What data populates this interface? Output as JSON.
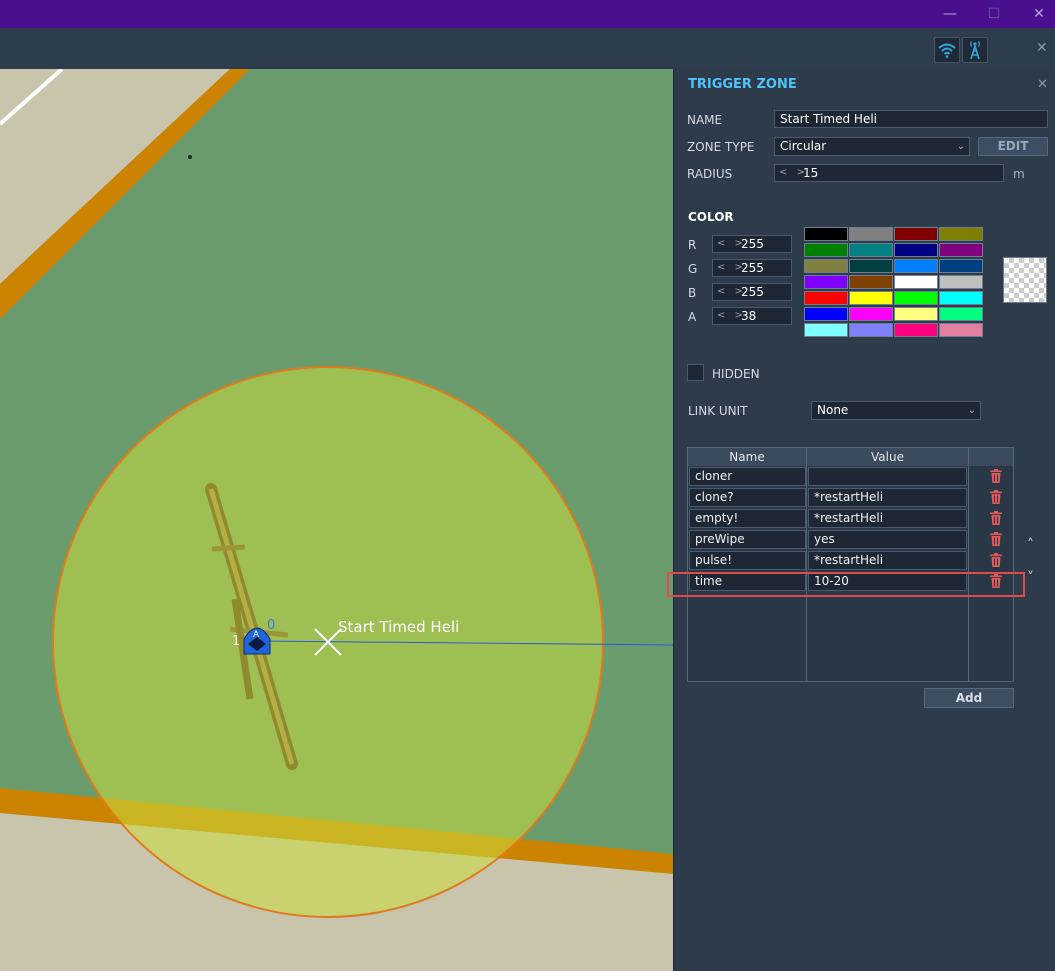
{
  "window": {
    "minimize_glyph": "—",
    "maximize_glyph": "☐",
    "close_glyph": "✕",
    "accent_color": "#4a0f8f"
  },
  "toolbar": {
    "icons": [
      "wifi-icon",
      "radio-tower-icon"
    ],
    "close_glyph": "✕"
  },
  "map": {
    "zone_label": "Start Timed Heli",
    "unit_marker_left_label": "1",
    "unit_marker_right_label": "0",
    "unit_marker_letter": "A",
    "zone_fill_color": "#c8dc3c",
    "zone_fill_opacity": 0.55,
    "zone_border_color": "#e07a1c"
  },
  "panel": {
    "title": "TRIGGER ZONE",
    "close_glyph": "✕",
    "name_label": "NAME",
    "name_value": "Start Timed Heli",
    "zone_type_label": "ZONE TYPE",
    "zone_type_value": "Circular",
    "edit_label": "EDIT",
    "radius_label": "RADIUS",
    "radius_value": "15",
    "radius_unit": "m",
    "color": {
      "section_label": "COLOR",
      "r_label": "R",
      "r_value": "255",
      "g_label": "G",
      "g_value": "255",
      "b_label": "B",
      "b_value": "255",
      "a_label": "A",
      "a_value": "38",
      "palette": [
        "#000000",
        "#808080",
        "#800000",
        "#808000",
        "#008000",
        "#008080",
        "#000080",
        "#800080",
        "#808040",
        "#004040",
        "#0080ff",
        "#004080",
        "#8000ff",
        "#804000",
        "#ffffff",
        "#c0c0c0",
        "#ff0000",
        "#ffff00",
        "#00ff00",
        "#00ffff",
        "#0000ff",
        "#ff00ff",
        "#ffff80",
        "#00ff80",
        "#80ffff",
        "#8080ff",
        "#ff0080",
        "#e080a0"
      ]
    },
    "hidden_label": "HIDDEN",
    "link_unit_label": "LINK UNIT",
    "link_unit_value": "None",
    "properties": {
      "col_name": "Name",
      "col_value": "Value",
      "rows": [
        {
          "name": "cloner",
          "value": ""
        },
        {
          "name": "clone?",
          "value": "*restartHeli"
        },
        {
          "name": "empty!",
          "value": "*restartHeli"
        },
        {
          "name": "preWipe",
          "value": "yes"
        },
        {
          "name": "pulse!",
          "value": "*restartHeli"
        },
        {
          "name": "time",
          "value": "10-20"
        }
      ],
      "highlight_color": "#e04a4a"
    },
    "add_label": "Add",
    "scroll_up_glyph": "˄",
    "scroll_down_glyph": "˅"
  }
}
